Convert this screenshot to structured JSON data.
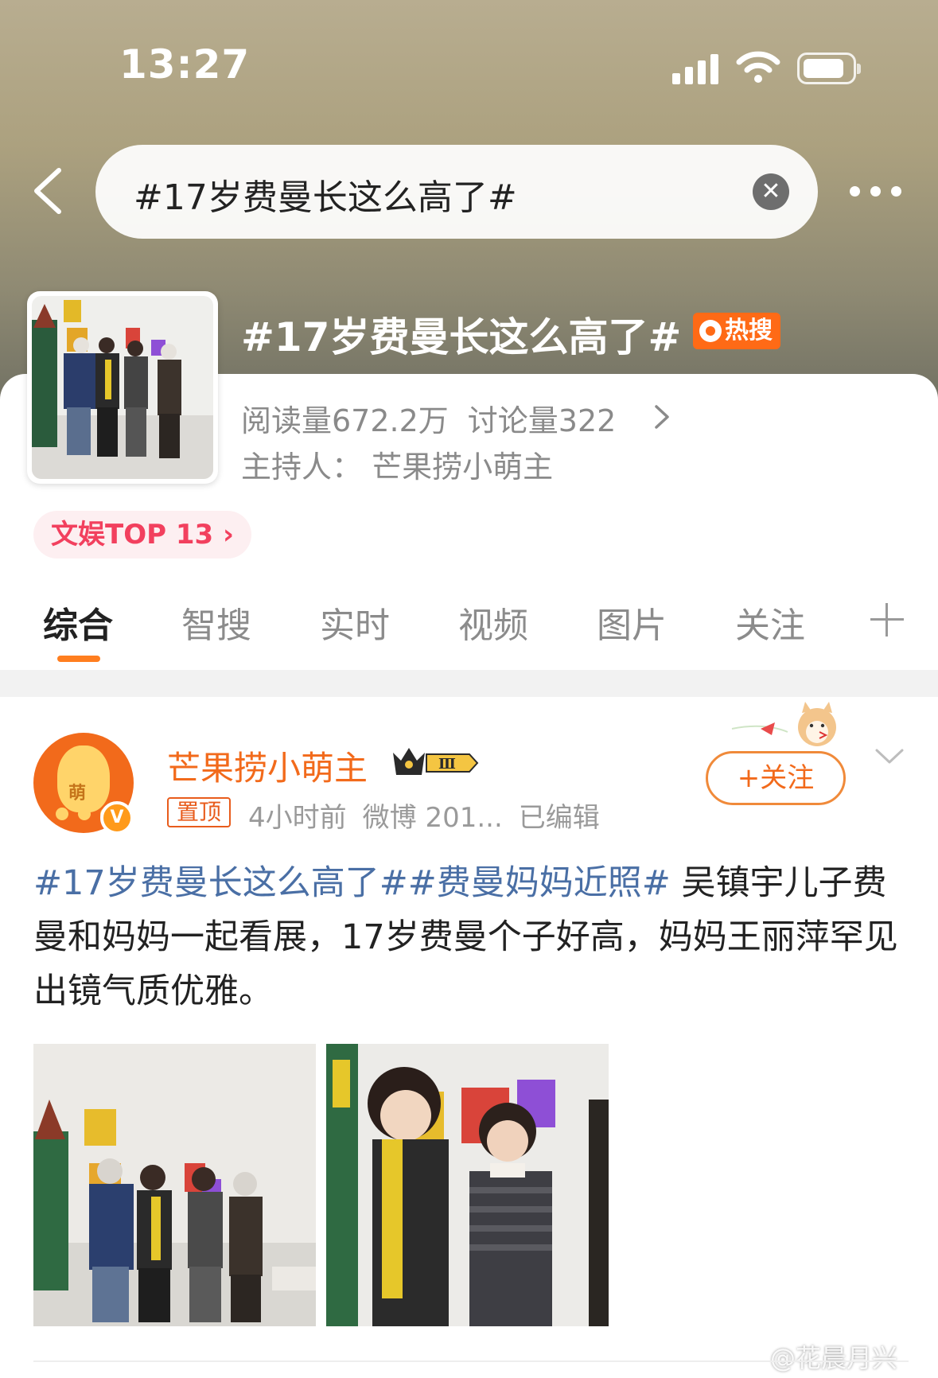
{
  "status_bar": {
    "time": "13:27"
  },
  "search": {
    "query": "#17岁费曼长这么高了#"
  },
  "topic": {
    "title": "#17岁费曼长这么高了#",
    "hot_badge": "热搜",
    "stats_line": "阅读量672.2万",
    "discussion": "讨论量322",
    "host": "主持人：  芒果捞小萌主",
    "rank": "文娱TOP 13"
  },
  "tabs": [
    {
      "label": "综合"
    },
    {
      "label": "智搜"
    },
    {
      "label": "实时"
    },
    {
      "label": "视频"
    },
    {
      "label": "图片"
    },
    {
      "label": "关注"
    }
  ],
  "post": {
    "author": "芒果捞小萌主",
    "crown_level": "Ⅲ",
    "pinned": "置顶",
    "time": "4小时前",
    "source": "微博 201...",
    "edited": "已编辑",
    "follow": "+关注",
    "avatar_glyph": "萌",
    "verified": "V",
    "hashtag1": "#17岁费曼长这么高了#",
    "hashtag2": "#费曼妈妈近照#",
    "body": " 吴镇宇儿子费曼和妈妈一起看展，17岁费曼个子好高，妈妈王丽萍罕见出镜气质优雅。"
  },
  "watermark": "@花晨月兴",
  "colors": {
    "accent": "#ff7e1f",
    "hot": "#ff6a16",
    "link": "#4a6fa5",
    "rank": "#f2405e"
  }
}
